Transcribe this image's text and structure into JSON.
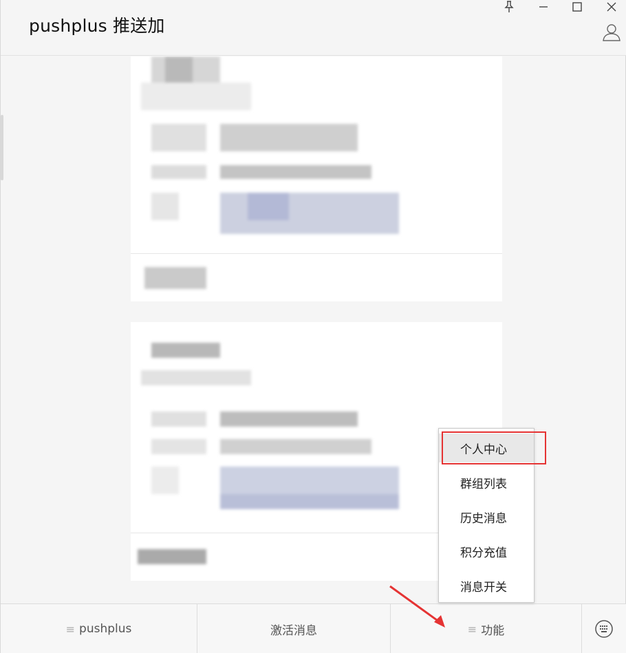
{
  "window": {
    "title": "pushplus 推送加",
    "controls": [
      "pin-icon",
      "minimize-icon",
      "maximize-icon",
      "close-icon"
    ],
    "profile_icon": "user-icon"
  },
  "bottom_bar": {
    "tabs": [
      {
        "label": "pushplus",
        "has_menu_icon": true
      },
      {
        "label": "激活消息",
        "has_menu_icon": false
      },
      {
        "label": "功能",
        "has_menu_icon": true
      }
    ],
    "keyboard_icon": "keyboard-icon"
  },
  "function_menu": {
    "items": [
      {
        "label": "个人中心",
        "highlighted": true
      },
      {
        "label": "群组列表"
      },
      {
        "label": "历史消息"
      },
      {
        "label": "积分充值"
      },
      {
        "label": "消息开关"
      }
    ]
  },
  "annotations": {
    "highlight_color": "#e53333",
    "arrow_color": "#e53333"
  }
}
